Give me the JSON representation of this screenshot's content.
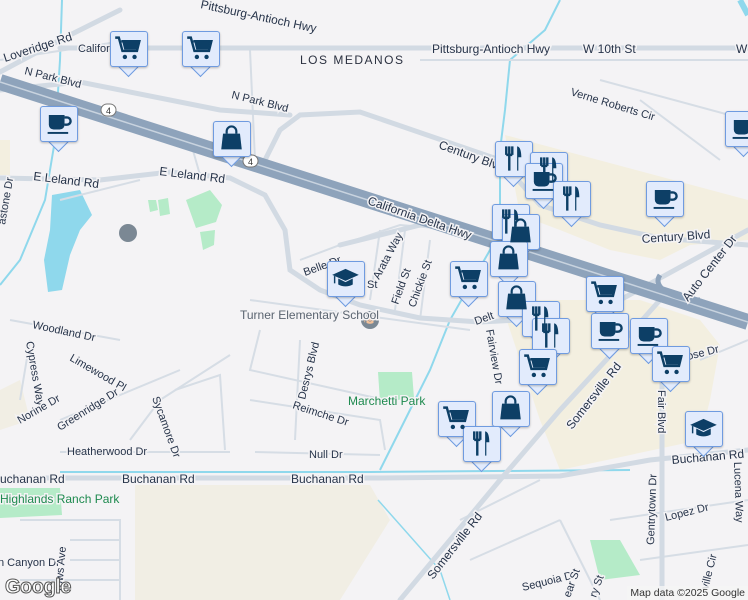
{
  "map": {
    "area_labels": {
      "los_medanos": "LOS MEDANOS"
    },
    "roads": {
      "pittsburg_antioch_hwy_top": "Pittsburg-Antioch Hwy",
      "pittsburg_antioch_hwy": "Pittsburg-Antioch Hwy",
      "w_10th_st": "W 10th St",
      "w_cut": "W",
      "loveridge_rd": "Loveridge Rd",
      "california_cut": "Califor",
      "n_park_blvd_1": "N Park Blvd",
      "n_park_blvd_2": "N Park Blvd",
      "verne_roberts_cir": "Verne Roberts Cir",
      "century_blvd_1": "Century Blvd",
      "century_blvd_2": "Century Blvd",
      "e_leland_rd_1": "E Leland Rd",
      "e_leland_rd_2": "E Leland Rd",
      "california_delta_hwy": "California Delta Hwy",
      "auto_center_dr": "Auto Center Dr",
      "belle_dr": "Belle Dr",
      "arata_way": "Arata Way",
      "field_st": "Field St",
      "chickie_st": "Chickie St",
      "st_cut": "St",
      "delta_cut": "Delt",
      "fairview_dr": "Fairview Dr",
      "somersville_rd_1": "Somersville Rd",
      "somersville_rd_2": "Somersville Rd",
      "fair_blvd": "Fair Blvd",
      "rose_dr": "ose Dr",
      "woodland_dr": "Woodland Dr",
      "cypress_way": "Cypress Way",
      "limewood_pl": "Limewood Pl",
      "norine_dr": "Norine Dr",
      "greenridge_dr": "Greenridge Dr",
      "sycamore_dr": "Sycamore Dr",
      "desrys_blvd": "Desrys Blvd",
      "reimche_dr": "Reimche Dr",
      "heatherwood_dr": "Heatherwood Dr",
      "null_dr": "Null Dr",
      "buchanan_rd_1": "Buchanan Rd",
      "buchanan_rd_2": "Buchanan Rd",
      "buchanan_rd_3": "Buchanan Rd",
      "buchanan_rd_4": "Buchanan Rd",
      "stone_dr": "astone Dr",
      "canyon_dr": "n Canyon Dr",
      "rows_ave": "rows Ave",
      "gentrytown_dr": "Gentrytown Dr",
      "lopez_dr": "Lopez Dr",
      "lucena_way": "Lucena Way",
      "sequoia_dr": "Sequoia Dr",
      "ear_st": "ear St",
      "ry_st": "ry St",
      "ville_cir": "ville Cir"
    },
    "highway_shield": "4",
    "places": {
      "turner_school": "Turner Elementary School",
      "marchetti_park": "Marchetti Park",
      "highlands_park": "Highlands Ranch Park"
    },
    "markers": [
      {
        "type": "cart"
      },
      {
        "type": "cart"
      },
      {
        "type": "coffee"
      },
      {
        "type": "bag"
      },
      {
        "type": "school"
      },
      {
        "type": "restaurant"
      },
      {
        "type": "restaurant"
      },
      {
        "type": "coffee"
      },
      {
        "type": "restaurant"
      },
      {
        "type": "coffee"
      },
      {
        "type": "coffee"
      },
      {
        "type": "restaurant"
      },
      {
        "type": "bag"
      },
      {
        "type": "bag"
      },
      {
        "type": "cart"
      },
      {
        "type": "bag"
      },
      {
        "type": "restaurant"
      },
      {
        "type": "restaurant"
      },
      {
        "type": "cart"
      },
      {
        "type": "cart"
      },
      {
        "type": "coffee"
      },
      {
        "type": "coffee"
      },
      {
        "type": "cart"
      },
      {
        "type": "bag"
      },
      {
        "type": "cart"
      },
      {
        "type": "restaurant"
      },
      {
        "type": "school"
      }
    ],
    "colors": {
      "marker_fill": "#e2ebfc",
      "marker_border": "#6f9be0",
      "icon": "#0d3f66",
      "highway": "#8ea3bb",
      "water": "#8fd8ec",
      "park": "#b5ebc8",
      "commercial": "#f3efe0"
    },
    "logo": "Google",
    "attribution": "Map data ©2025 Google"
  }
}
